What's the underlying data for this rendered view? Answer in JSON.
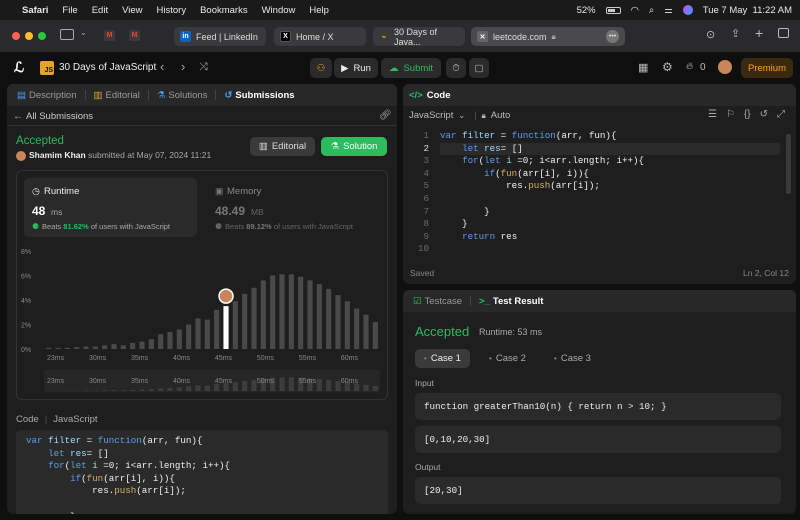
{
  "menubar": {
    "app": "Safari",
    "items": [
      "File",
      "Edit",
      "View",
      "History",
      "Bookmarks",
      "Window",
      "Help"
    ],
    "battery": "52%",
    "datetime": "Tue 7 May  11:22 AM"
  },
  "browser": {
    "tabs": [
      "Feed | LinkedIn",
      "Home / X",
      "30 Days of Java...",
      "leetcode.com"
    ],
    "url": "leetcode.com"
  },
  "nav": {
    "problem_badge": "JS",
    "problem_list": "30 Days of JavaScript",
    "run": "Run",
    "submit": "Submit",
    "premium": "Premium",
    "streak": "0"
  },
  "left": {
    "tabs": [
      "Description",
      "Editorial",
      "Solutions",
      "Submissions"
    ],
    "back": "All Submissions",
    "status": "Accepted",
    "author": "Shamim Khan",
    "submitted": "submitted at May 07, 2024 11:21",
    "editorial_btn": "Editorial",
    "solution_btn": "Solution",
    "runtime": {
      "label": "Runtime",
      "value": "48",
      "unit": "ms",
      "beats_prefix": "Beats",
      "beats": "81.62%",
      "beats_suffix": "of users with JavaScript"
    },
    "memory": {
      "label": "Memory",
      "value": "48.49",
      "unit": "MB",
      "beats_prefix": "Beats",
      "beats": "89.12%",
      "beats_suffix": "of users with JavaScript"
    },
    "code_label": "Code",
    "code_lang": "JavaScript"
  },
  "chart_data": {
    "type": "bar",
    "y_ticks": [
      "8%",
      "6%",
      "4%",
      "2%",
      "0%"
    ],
    "ylim": [
      0,
      8
    ],
    "x_ticks": [
      "23ms",
      "30ms",
      "35ms",
      "40ms",
      "45ms",
      "50ms",
      "55ms",
      "60ms"
    ],
    "values": [
      0.1,
      0.1,
      0.1,
      0.15,
      0.2,
      0.2,
      0.3,
      0.4,
      0.3,
      0.5,
      0.6,
      0.8,
      1.2,
      1.4,
      1.6,
      2.0,
      2.5,
      2.4,
      3.2,
      3.5,
      3.9,
      4.5,
      5.0,
      5.6,
      6.0,
      6.1,
      6.1,
      5.9,
      5.6,
      5.3,
      4.9,
      4.4,
      3.9,
      3.3,
      2.8,
      2.2
    ],
    "highlight_index": 19,
    "colors": {
      "bar": "#4a4a4a",
      "highlight": "#ffffff"
    }
  },
  "editor": {
    "title": "Code",
    "language": "JavaScript",
    "mode": "Auto",
    "saved": "Saved",
    "cursor": "Ln 2, Col 12"
  },
  "result": {
    "tabs": [
      "Testcase",
      "Test Result"
    ],
    "status": "Accepted",
    "runtime": "Runtime: 53 ms",
    "cases": [
      "Case 1",
      "Case 2",
      "Case 3"
    ],
    "input_label": "Input",
    "input1": "function greaterThan10(n) { return n > 10; }",
    "input2": "[0,10,20,30]",
    "output_label": "Output",
    "output": "[20,30]"
  }
}
